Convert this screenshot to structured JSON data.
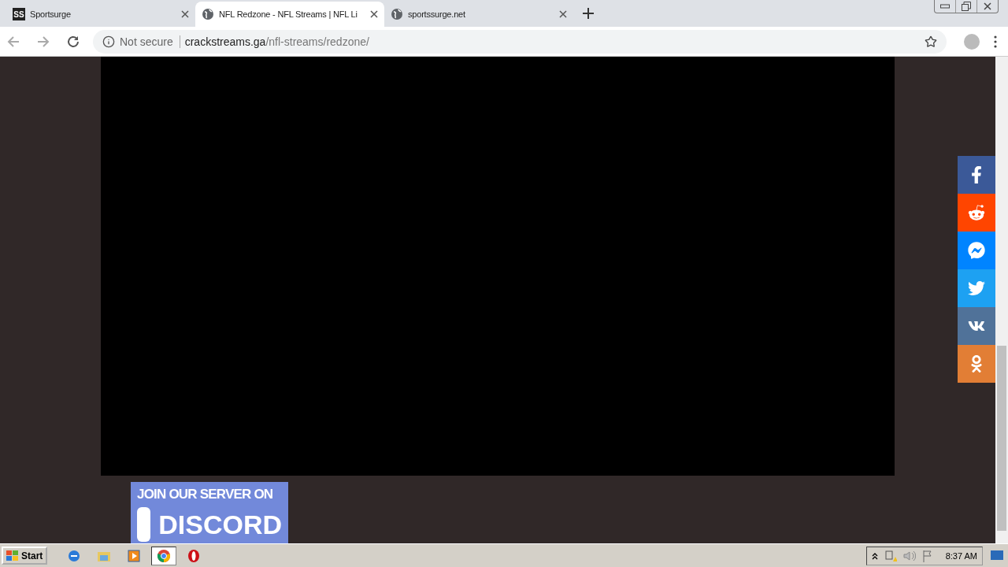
{
  "tabs": [
    {
      "title": "Sportsurge",
      "favicon": {
        "kind": "logo",
        "text": "SS"
      },
      "selected": false
    },
    {
      "title": "NFL Redzone - NFL Streams | NFL Li",
      "favicon": {
        "kind": "globe"
      },
      "selected": true
    },
    {
      "title": "sportssurge.net",
      "favicon": {
        "kind": "globe"
      },
      "selected": false
    }
  ],
  "address_bar": {
    "security": "Not secure",
    "host": "crackstreams.ga",
    "path": "/nfl-streams/redzone/"
  },
  "share_buttons": [
    {
      "kind": "facebook",
      "color": "#3b5998"
    },
    {
      "kind": "reddit",
      "color": "#ff4500"
    },
    {
      "kind": "messenger",
      "color": "#0084ff"
    },
    {
      "kind": "twitter",
      "color": "#1da1f2"
    },
    {
      "kind": "vk",
      "color": "#507299"
    },
    {
      "kind": "ok",
      "color": "#e27e35"
    }
  ],
  "banner": {
    "line_1": "JOIN OUR SERVER ON",
    "line_2": "DISCORD"
  },
  "taskbar": {
    "start": "Start",
    "apps": [
      {
        "kind": "ie",
        "selected": false
      },
      {
        "kind": "folder",
        "selected": false
      },
      {
        "kind": "media",
        "selected": false
      },
      {
        "kind": "chrome",
        "selected": true
      },
      {
        "kind": "opera",
        "selected": false
      }
    ],
    "clock": "8:37 AM"
  }
}
